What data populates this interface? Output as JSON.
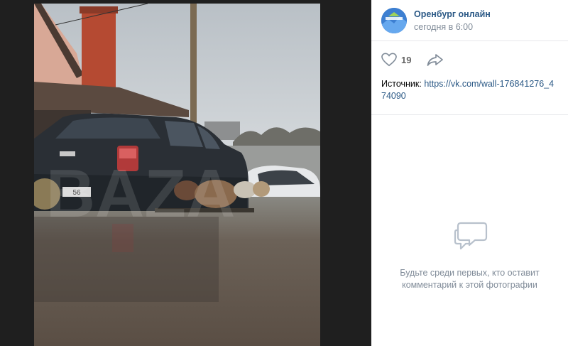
{
  "post": {
    "group_name": "Оренбург онлайн",
    "time": "сегодня в 6:00",
    "likes": "19",
    "source_label": "Источник:",
    "source_link": "https://vk.com/wall-176841276_474090"
  },
  "comments": {
    "empty_text": "Будьте среди первых, кто оставит комментарий к этой фотографии"
  },
  "photo": {
    "watermark": "BAZA",
    "plate_fragment": "56"
  },
  "icons": {
    "like": "heart-icon",
    "share": "share-arrow-icon",
    "comment": "comment-bubbles-icon"
  },
  "colors": {
    "link": "#2a5885",
    "muted": "#818c99",
    "viewer_bg": "#1f1f1f"
  }
}
